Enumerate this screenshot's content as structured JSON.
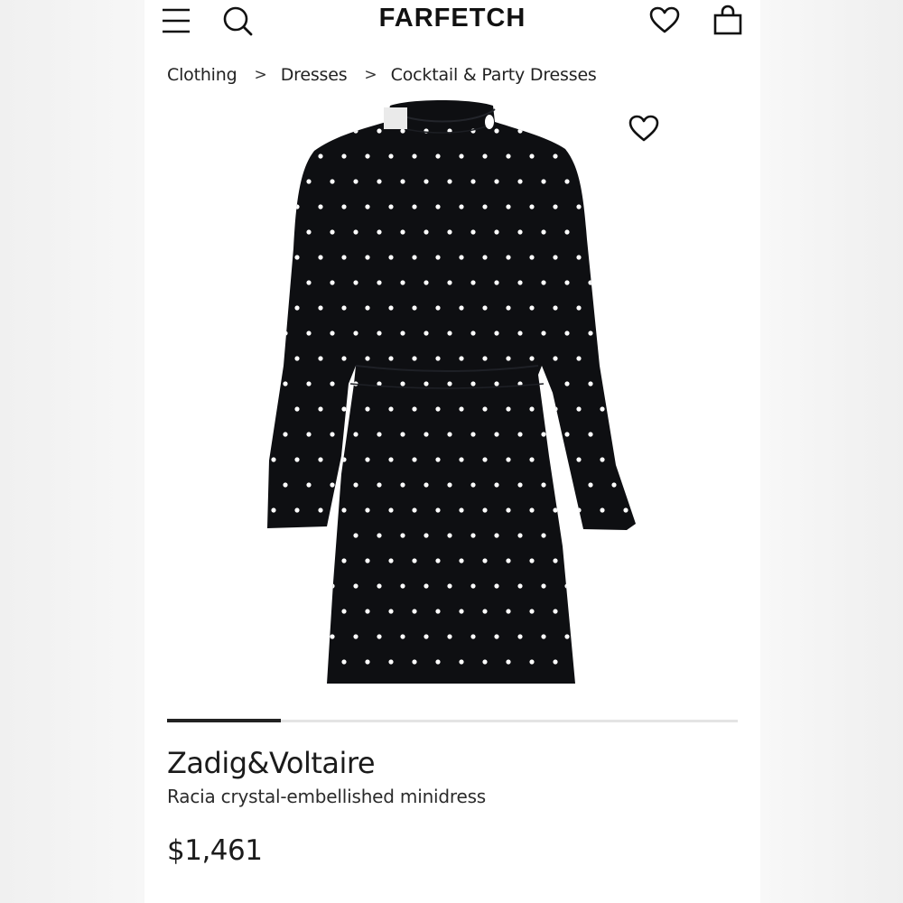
{
  "header": {
    "logo": "FARFETCH",
    "menu_icon": "hamburger-menu-icon",
    "search_icon": "search-icon",
    "wishlist_icon": "heart-icon",
    "bag_icon": "shopping-bag-icon"
  },
  "breadcrumb": {
    "items": [
      "Clothing",
      "Dresses",
      "Cocktail & Party Dresses"
    ],
    "separator": ">"
  },
  "product": {
    "image_wishlist_icon": "heart-icon",
    "image_alt": "black long-sleeve crystal-embellished minidress",
    "carousel_progress": 0.2,
    "brand": "Zadig&Voltaire",
    "name": "Racia crystal-embellished minidress",
    "price": "$1,461"
  },
  "colors": {
    "dress": "#0e0f12",
    "crystals": "#ffffff",
    "text": "#222222",
    "track": "#e4e4e4"
  }
}
